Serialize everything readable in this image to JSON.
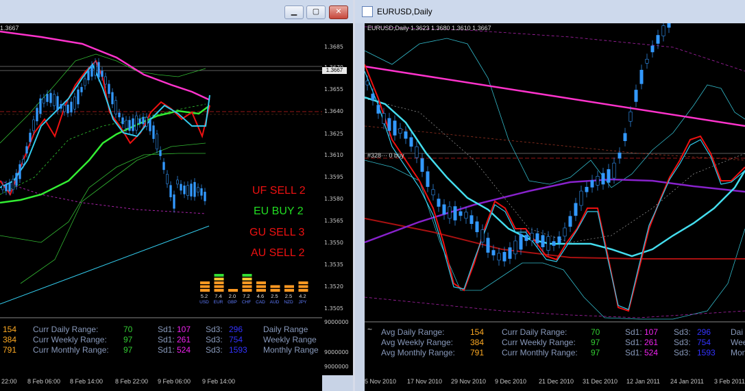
{
  "colors": {
    "bg": "#000000",
    "ma_magenta": "#ff33cc",
    "ma_cyan": "#33ccee",
    "ma_green": "#33ee33",
    "candle_blue": "#3399ff",
    "signal_red": "#ee1111",
    "signal_green": "#22dd22",
    "orange": "#ffaa22",
    "green_text": "#33cc33",
    "steel_text": "#8899bb",
    "magenta_text": "#ee22ee",
    "blue_text": "#3333ff"
  },
  "left_window": {
    "controls": {
      "minimize": "▁",
      "maximize": "▢",
      "close": "✕"
    },
    "top_label": "1.3667",
    "price_ticks": [
      "1.3685",
      "1.3670",
      "1.3667",
      "1.3655",
      "1.3640",
      "1.3625",
      "1.3610",
      "1.3595",
      "1.3580",
      "1.3565",
      "1.3550",
      "1.3535",
      "1.3520",
      "1.3505",
      "9000000",
      "9000000",
      "9000000"
    ],
    "time_ticks": [
      "22:00",
      "8 Feb 06:00",
      "8 Feb 14:00",
      "8 Feb 22:00",
      "9 Feb 06:00",
      "9 Feb 14:00"
    ],
    "signals": [
      {
        "text": "UF SELL 2",
        "color": "#ee1111"
      },
      {
        "text": "EU BUY 2",
        "color": "#22dd22"
      },
      {
        "text": "GU SELL 3",
        "color": "#ee1111"
      },
      {
        "text": "AU SELL 2",
        "color": "#ee1111"
      }
    ],
    "strength_meter": [
      {
        "value": "5.2",
        "code": "USD",
        "level": 3,
        "top": "orange"
      },
      {
        "value": "7.4",
        "code": "EUR",
        "level": 5,
        "top": "green"
      },
      {
        "value": "2.0",
        "code": "GBP",
        "level": 1,
        "top": "orange"
      },
      {
        "value": "7.2",
        "code": "CHF",
        "level": 5,
        "top": "green"
      },
      {
        "value": "4.6",
        "code": "CAD",
        "level": 3,
        "top": "orange"
      },
      {
        "value": "2.5",
        "code": "AUD",
        "level": 2,
        "top": "orange"
      },
      {
        "value": "2.5",
        "code": "NZD",
        "level": 2,
        "top": "orange"
      },
      {
        "value": "4.2",
        "code": "JPY",
        "level": 3,
        "top": "orange"
      }
    ],
    "stats": [
      {
        "avg": "154",
        "curr_label": "Curr Daily Range:",
        "curr": "70",
        "sd1_label": "Sd1:",
        "sd1": "107",
        "sd3_label": "Sd3:",
        "sd3": "296",
        "range_label": "Daily Range"
      },
      {
        "avg": "384",
        "curr_label": "Curr Weekly Range:",
        "curr": "97",
        "sd1_label": "Sd1:",
        "sd1": "261",
        "sd3_label": "Sd3:",
        "sd3": "754",
        "range_label": "Weekly Range"
      },
      {
        "avg": "791",
        "curr_label": "Curr Monthly Range:",
        "curr": "97",
        "sd1_label": "Sd1:",
        "sd1": "524",
        "sd3_label": "Sd3:",
        "sd3": "1593",
        "range_label": "Monthly Range"
      }
    ]
  },
  "right_window": {
    "title": "EURUSD,Daily",
    "chart_label": "EURUSD,Daily  1.3623 1.3680 1.3610 1.3667",
    "order_label": "#328··· 0 buy",
    "tilde": "~",
    "time_ticks": [
      "5 Nov 2010",
      "17 Nov 2010",
      "29 Nov 2010",
      "9 Dec 2010",
      "21 Dec 2010",
      "31 Dec 2010",
      "12 Jan 2011",
      "24 Jan 2011",
      "3 Feb 2011"
    ],
    "stats": [
      {
        "avg_label": "Avg Daily Range:",
        "avg": "154",
        "curr_label": "Curr Daily Range:",
        "curr": "70",
        "sd1_label": "Sd1:",
        "sd1": "107",
        "sd3_label": "Sd3:",
        "sd3": "296",
        "range_label": "Dai"
      },
      {
        "avg_label": "Avg Weekly Range:",
        "avg": "384",
        "curr_label": "Curr Weekly Range:",
        "curr": "97",
        "sd1_label": "Sd1:",
        "sd1": "261",
        "sd3_label": "Sd3:",
        "sd3": "754",
        "range_label": "Wee"
      },
      {
        "avg_label": "Avg Monthly Range:",
        "avg": "791",
        "curr_label": "Curr Monthly Range:",
        "curr": "97",
        "sd1_label": "Sd1:",
        "sd1": "524",
        "sd3_label": "Sd3:",
        "sd3": "1593",
        "range_label": "Mon"
      }
    ]
  }
}
